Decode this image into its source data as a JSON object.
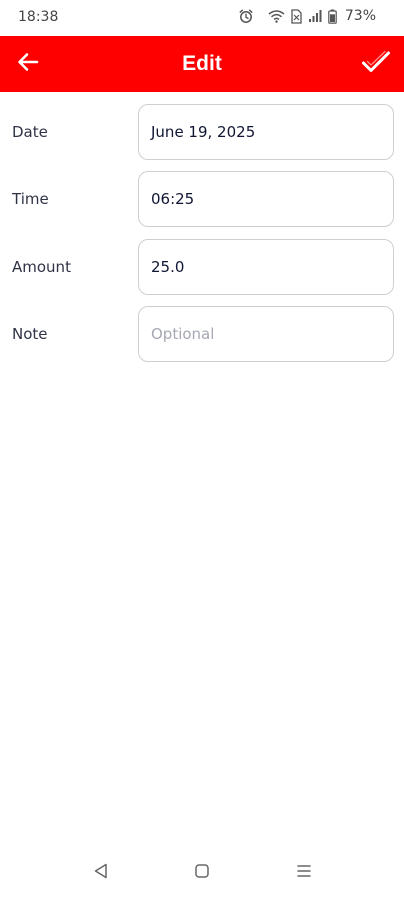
{
  "status_bar": {
    "time": "18:38",
    "battery_percent": "73%",
    "icons": [
      "alarm-icon",
      "wifi-icon",
      "no-sim-icon",
      "signal-icon",
      "battery-icon"
    ]
  },
  "app_bar": {
    "title": "Edit",
    "background_color": "#ff0000",
    "back_icon": "arrow-left-icon",
    "confirm_icon": "check-icon"
  },
  "form": {
    "date": {
      "label": "Date",
      "value": "June 19, 2025"
    },
    "time": {
      "label": "Time",
      "value": "06:25"
    },
    "amount": {
      "label": "Amount",
      "value": "25.0"
    },
    "note": {
      "label": "Note",
      "value": "",
      "placeholder": "Optional"
    }
  },
  "nav_bar": {
    "icons": [
      "nav-back-icon",
      "nav-home-icon",
      "nav-recents-icon"
    ]
  }
}
